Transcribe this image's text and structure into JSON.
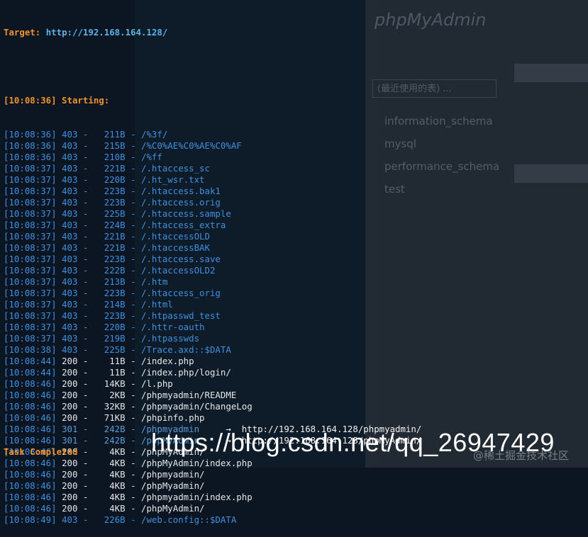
{
  "target_label": "Target: ",
  "target_url": "http://192.168.164.128/",
  "starting": "[10:08:36] Starting:",
  "results": [
    {
      "time": "[10:08:36]",
      "code": "403",
      "size": "211B",
      "path": "/%3f/",
      "redirect": ""
    },
    {
      "time": "[10:08:36]",
      "code": "403",
      "size": "215B",
      "path": "/%C0%AE%C0%AE%C0%AF",
      "redirect": ""
    },
    {
      "time": "[10:08:36]",
      "code": "403",
      "size": "210B",
      "path": "/%ff",
      "redirect": ""
    },
    {
      "time": "[10:08:37]",
      "code": "403",
      "size": "221B",
      "path": "/.htaccess_sc",
      "redirect": ""
    },
    {
      "time": "[10:08:37]",
      "code": "403",
      "size": "220B",
      "path": "/.ht_wsr.txt",
      "redirect": ""
    },
    {
      "time": "[10:08:37]",
      "code": "403",
      "size": "223B",
      "path": "/.htaccess.bak1",
      "redirect": ""
    },
    {
      "time": "[10:08:37]",
      "code": "403",
      "size": "223B",
      "path": "/.htaccess.orig",
      "redirect": ""
    },
    {
      "time": "[10:08:37]",
      "code": "403",
      "size": "225B",
      "path": "/.htaccess.sample",
      "redirect": ""
    },
    {
      "time": "[10:08:37]",
      "code": "403",
      "size": "224B",
      "path": "/.htaccess_extra",
      "redirect": ""
    },
    {
      "time": "[10:08:37]",
      "code": "403",
      "size": "221B",
      "path": "/.htaccessOLD",
      "redirect": ""
    },
    {
      "time": "[10:08:37]",
      "code": "403",
      "size": "221B",
      "path": "/.htaccessBAK",
      "redirect": ""
    },
    {
      "time": "[10:08:37]",
      "code": "403",
      "size": "223B",
      "path": "/.htaccess.save",
      "redirect": ""
    },
    {
      "time": "[10:08:37]",
      "code": "403",
      "size": "222B",
      "path": "/.htaccessOLD2",
      "redirect": ""
    },
    {
      "time": "[10:08:37]",
      "code": "403",
      "size": "213B",
      "path": "/.htm",
      "redirect": ""
    },
    {
      "time": "[10:08:37]",
      "code": "403",
      "size": "223B",
      "path": "/.htaccess_orig",
      "redirect": ""
    },
    {
      "time": "[10:08:37]",
      "code": "403",
      "size": "214B",
      "path": "/.html",
      "redirect": ""
    },
    {
      "time": "[10:08:37]",
      "code": "403",
      "size": "223B",
      "path": "/.htpasswd_test",
      "redirect": ""
    },
    {
      "time": "[10:08:37]",
      "code": "403",
      "size": "220B",
      "path": "/.httr-oauth",
      "redirect": ""
    },
    {
      "time": "[10:08:37]",
      "code": "403",
      "size": "219B",
      "path": "/.htpasswds",
      "redirect": ""
    },
    {
      "time": "[10:08:38]",
      "code": "403",
      "size": "225B",
      "path": "/Trace.axd::$DATA",
      "redirect": ""
    },
    {
      "time": "[10:08:44]",
      "code": "200",
      "size": "11B",
      "path": "/index.php",
      "redirect": ""
    },
    {
      "time": "[10:08:44]",
      "code": "200",
      "size": "11B",
      "path": "/index.php/login/",
      "redirect": ""
    },
    {
      "time": "[10:08:46]",
      "code": "200",
      "size": "14KB",
      "path": "/l.php",
      "redirect": ""
    },
    {
      "time": "[10:08:46]",
      "code": "200",
      "size": "2KB",
      "path": "/phpmyadmin/README",
      "redirect": ""
    },
    {
      "time": "[10:08:46]",
      "code": "200",
      "size": "32KB",
      "path": "/phpmyadmin/ChangeLog",
      "redirect": ""
    },
    {
      "time": "[10:08:46]",
      "code": "200",
      "size": "71KB",
      "path": "/phpinfo.php",
      "redirect": ""
    },
    {
      "time": "[10:08:46]",
      "code": "301",
      "size": "242B",
      "path": "/phpmyadmin",
      "redirect": "→  http://192.168.164.128/phpmyadmin/"
    },
    {
      "time": "[10:08:46]",
      "code": "301",
      "size": "242B",
      "path": "/phpMyAdmin",
      "redirect": "→  http://192.168.164.128/phpMyAdmin/"
    },
    {
      "time": "[10:08:46]",
      "code": "200",
      "size": "4KB",
      "path": "/phpMyAdmin/",
      "redirect": ""
    },
    {
      "time": "[10:08:46]",
      "code": "200",
      "size": "4KB",
      "path": "/phpMyAdmin/index.php",
      "redirect": ""
    },
    {
      "time": "[10:08:46]",
      "code": "200",
      "size": "4KB",
      "path": "/phpmyadmin/",
      "redirect": ""
    },
    {
      "time": "[10:08:46]",
      "code": "200",
      "size": "4KB",
      "path": "/phpMyadmin/",
      "redirect": ""
    },
    {
      "time": "[10:08:46]",
      "code": "200",
      "size": "4KB",
      "path": "/phpmyadmin/index.php",
      "redirect": ""
    },
    {
      "time": "[10:08:46]",
      "code": "200",
      "size": "4KB",
      "path": "/phpMyAdmin/",
      "redirect": ""
    },
    {
      "time": "[10:08:49]",
      "code": "403",
      "size": "226B",
      "path": "/web.config::$DATA",
      "redirect": ""
    }
  ],
  "task_completed": "Task Completed",
  "watermark": "https://blog.csdn.net/qq_26947429",
  "watermark_small": "@稀土掘金技术社区",
  "background": {
    "pma_logo": "phpMyAdmin",
    "db_list": [
      "information_schema",
      "mysql",
      "performance_schema",
      "test"
    ],
    "recent_tables": "(最近使用的表) ..."
  },
  "colors": {
    "bg": "#0b1622",
    "orange": "#f0922f",
    "blue": "#3f8fe0",
    "white": "#e6e6e6"
  }
}
